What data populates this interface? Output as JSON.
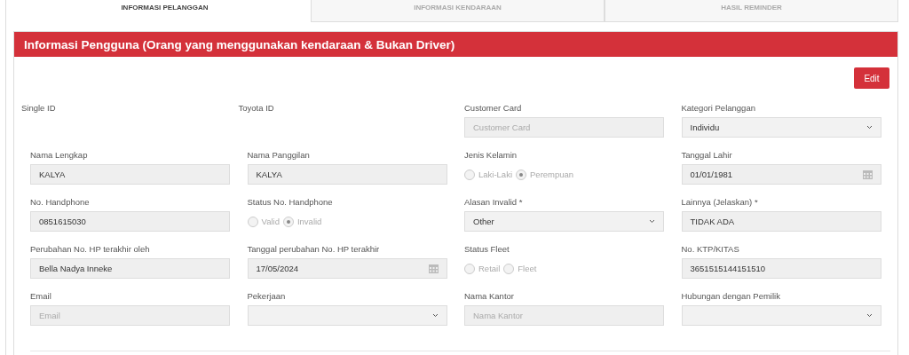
{
  "tabs": [
    {
      "label": "INFORMASI PELANGGAN",
      "selected": true
    },
    {
      "label": "INFORMASI KENDARAAN",
      "selected": false
    },
    {
      "label": "HASIL REMINDER",
      "selected": false
    }
  ],
  "panel": {
    "title": "Informasi Pengguna (Orang yang menggunakan kendaraan & Bukan Driver)",
    "edit_button": "Edit"
  },
  "fields": [
    {
      "label": "Single ID",
      "kind": "none"
    },
    {
      "label": "Toyota ID",
      "kind": "none"
    },
    {
      "label": "Customer Card",
      "kind": "text",
      "placeholder": "Customer Card"
    },
    {
      "label": "Kategori Pelanggan",
      "kind": "select",
      "value": "Individu"
    },
    {
      "label": "Nama Lengkap",
      "kind": "text",
      "value": "KALYA"
    },
    {
      "label": "Nama Panggilan",
      "kind": "text",
      "value": "KALYA"
    },
    {
      "label": "Jenis Kelamin",
      "kind": "radio",
      "options": [
        {
          "label": "Laki-Laki",
          "selected": false
        },
        {
          "label": "Perempuan",
          "selected": true
        }
      ]
    },
    {
      "label": "Tanggal Lahir",
      "kind": "date",
      "value": "01/01/1981"
    },
    {
      "label": "No. Handphone",
      "kind": "text",
      "value": "0851615030"
    },
    {
      "label": "Status No. Handphone",
      "kind": "radio",
      "options": [
        {
          "label": "Valid",
          "selected": false
        },
        {
          "label": "Invalid",
          "selected": true
        }
      ]
    },
    {
      "label": "Alasan Invalid *",
      "kind": "select",
      "value": "Other"
    },
    {
      "label": "Lainnya (Jelaskan) *",
      "kind": "text",
      "value": "TIDAK ADA"
    },
    {
      "label": "Perubahan No. HP terakhir oleh",
      "kind": "text",
      "value": "Bella Nadya Inneke"
    },
    {
      "label": "Tanggal perubahan No. HP terakhir",
      "kind": "date",
      "value": "17/05/2024"
    },
    {
      "label": "Status Fleet",
      "kind": "radio",
      "options": [
        {
          "label": "Retail",
          "selected": false
        },
        {
          "label": "Fleet",
          "selected": false
        }
      ]
    },
    {
      "label": "No. KTP/KITAS",
      "kind": "text",
      "value": "3651515144151510"
    },
    {
      "label": "Email",
      "kind": "text",
      "placeholder": "Email"
    },
    {
      "label": "Pekerjaan",
      "kind": "select"
    },
    {
      "label": "Nama Kantor",
      "kind": "text",
      "placeholder": "Nama Kantor"
    },
    {
      "label": "Hubungan dengan Pemilik",
      "kind": "select"
    }
  ]
}
